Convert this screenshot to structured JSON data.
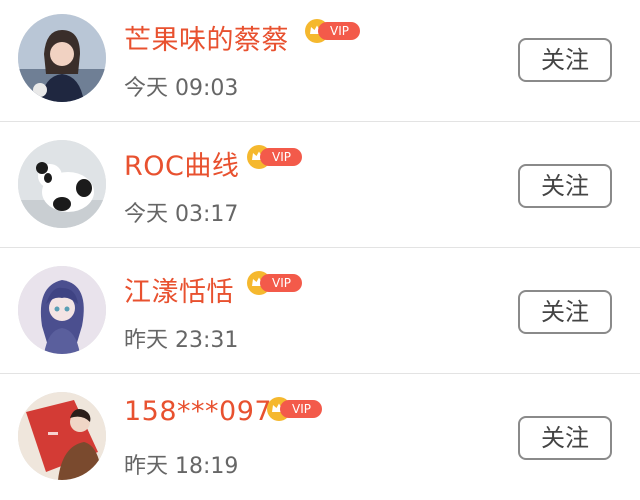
{
  "users": [
    {
      "name": "芒果味的蔡蔡",
      "badge": "VIP",
      "time": "今天 09:03",
      "follow_label": "关注"
    },
    {
      "name": "ROC曲线",
      "badge": "VIP",
      "time": "今天 03:17",
      "follow_label": "关注"
    },
    {
      "name": "江漾恬恬",
      "badge": "VIP",
      "time": "昨天 23:31",
      "follow_label": "关注"
    },
    {
      "name": "158***097",
      "badge": "VIP",
      "time": "昨天 18:19",
      "follow_label": "关注"
    }
  ],
  "colors": {
    "name": "#e8512f",
    "vip_badge": "#f35a4a",
    "crown": "#f5b82e"
  }
}
